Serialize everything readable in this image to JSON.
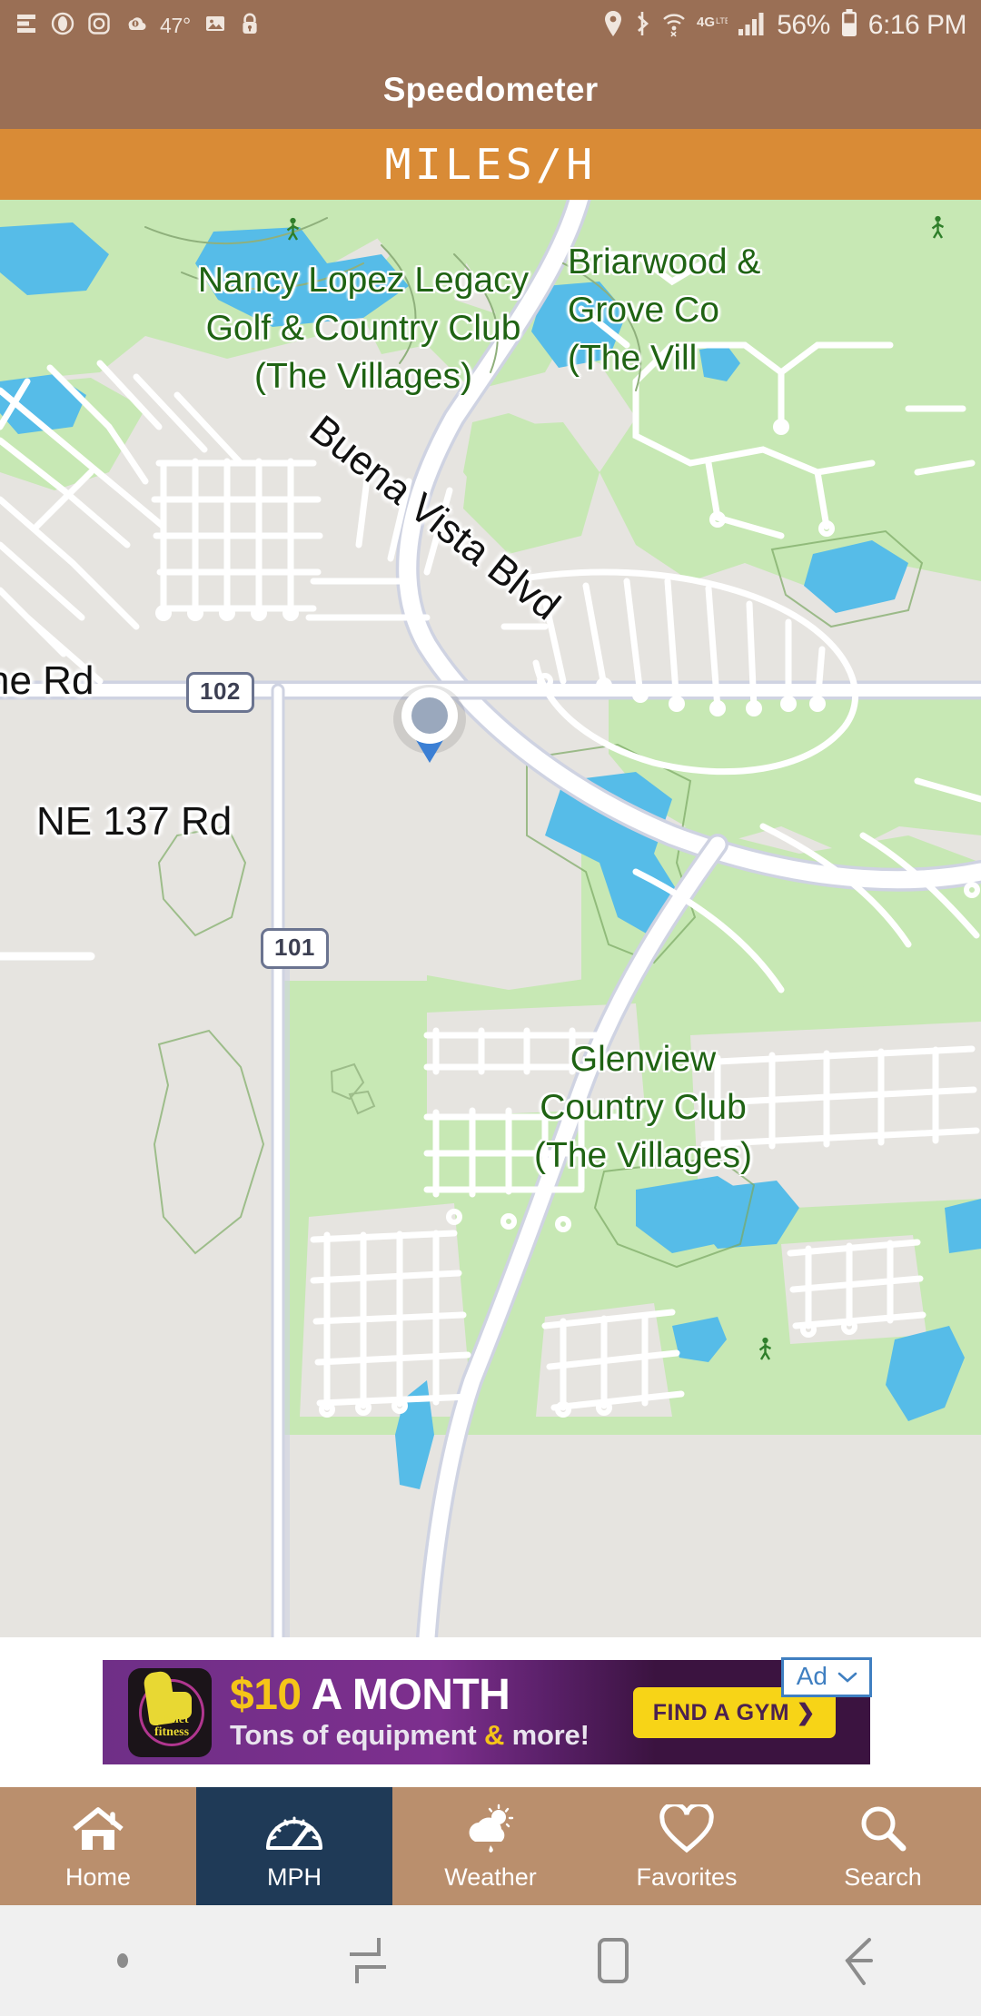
{
  "status_bar": {
    "left_icons": [
      "notification-lines-icon",
      "eye-icon",
      "instagram-icon",
      "weather-cloud-icon",
      "photos-icon",
      "lock-icon"
    ],
    "temperature": "47°",
    "right_icons": [
      "location-pin-icon",
      "bluetooth-icon",
      "wifi-icon",
      "4g-lte-icon",
      "signal-bars-icon",
      "battery-icon"
    ],
    "network": "4G",
    "battery_percent": "56%",
    "time": "6:16 PM"
  },
  "app_bar": {
    "title": "Speedometer"
  },
  "unit_bar": {
    "unit_label": "MILES/H",
    "background_color": "#d98b36"
  },
  "map": {
    "area_labels": [
      {
        "text": "Nancy Lopez Legacy\nGolf & Country Club\n(The Villages)",
        "color": "#1f6313"
      },
      {
        "text": "Briarwood &\nGrove Co\n(The Vill",
        "color": "#1f6313"
      },
      {
        "text": "Glenview\nCountry Club\n(The Villages)",
        "color": "#1f6313"
      }
    ],
    "road_labels": [
      {
        "text": "Buena Vista Blvd",
        "color": "#111111"
      },
      {
        "text": "ne Rd",
        "color": "#111111"
      },
      {
        "text": "NE 137 Rd",
        "color": "#111111"
      }
    ],
    "route_shields": [
      "102",
      "101"
    ],
    "marker": "current-location-marker",
    "colors": {
      "land": "#e6e4e0",
      "park": "#c7e8b4",
      "water": "#56bce8",
      "road": "#ffffff"
    }
  },
  "ad": {
    "badge_label": "Ad",
    "headline_price": "$10",
    "headline_rest": " A MONTH",
    "subline_a": "Tons of equipment ",
    "subline_amp": "&",
    "subline_b": " more!",
    "cta_label": "FIND A GYM ❯",
    "brand": "planet fitness",
    "brand_line1": "planet",
    "brand_line2": "fitness"
  },
  "bottom_nav": {
    "active_index": 1,
    "items": [
      {
        "label": "Home",
        "icon": "home-icon"
      },
      {
        "label": "MPH",
        "icon": "speedometer-icon"
      },
      {
        "label": "Weather",
        "icon": "weather-sun-cloud-rain-icon"
      },
      {
        "label": "Favorites",
        "icon": "heart-icon"
      },
      {
        "label": "Search",
        "icon": "search-icon"
      }
    ],
    "active_color": "#1f3a57",
    "background_color": "#ba8f6d"
  },
  "system_nav": {
    "buttons": [
      "dot-indicator",
      "recents-icon",
      "home-square-icon",
      "back-arrow-icon"
    ]
  }
}
